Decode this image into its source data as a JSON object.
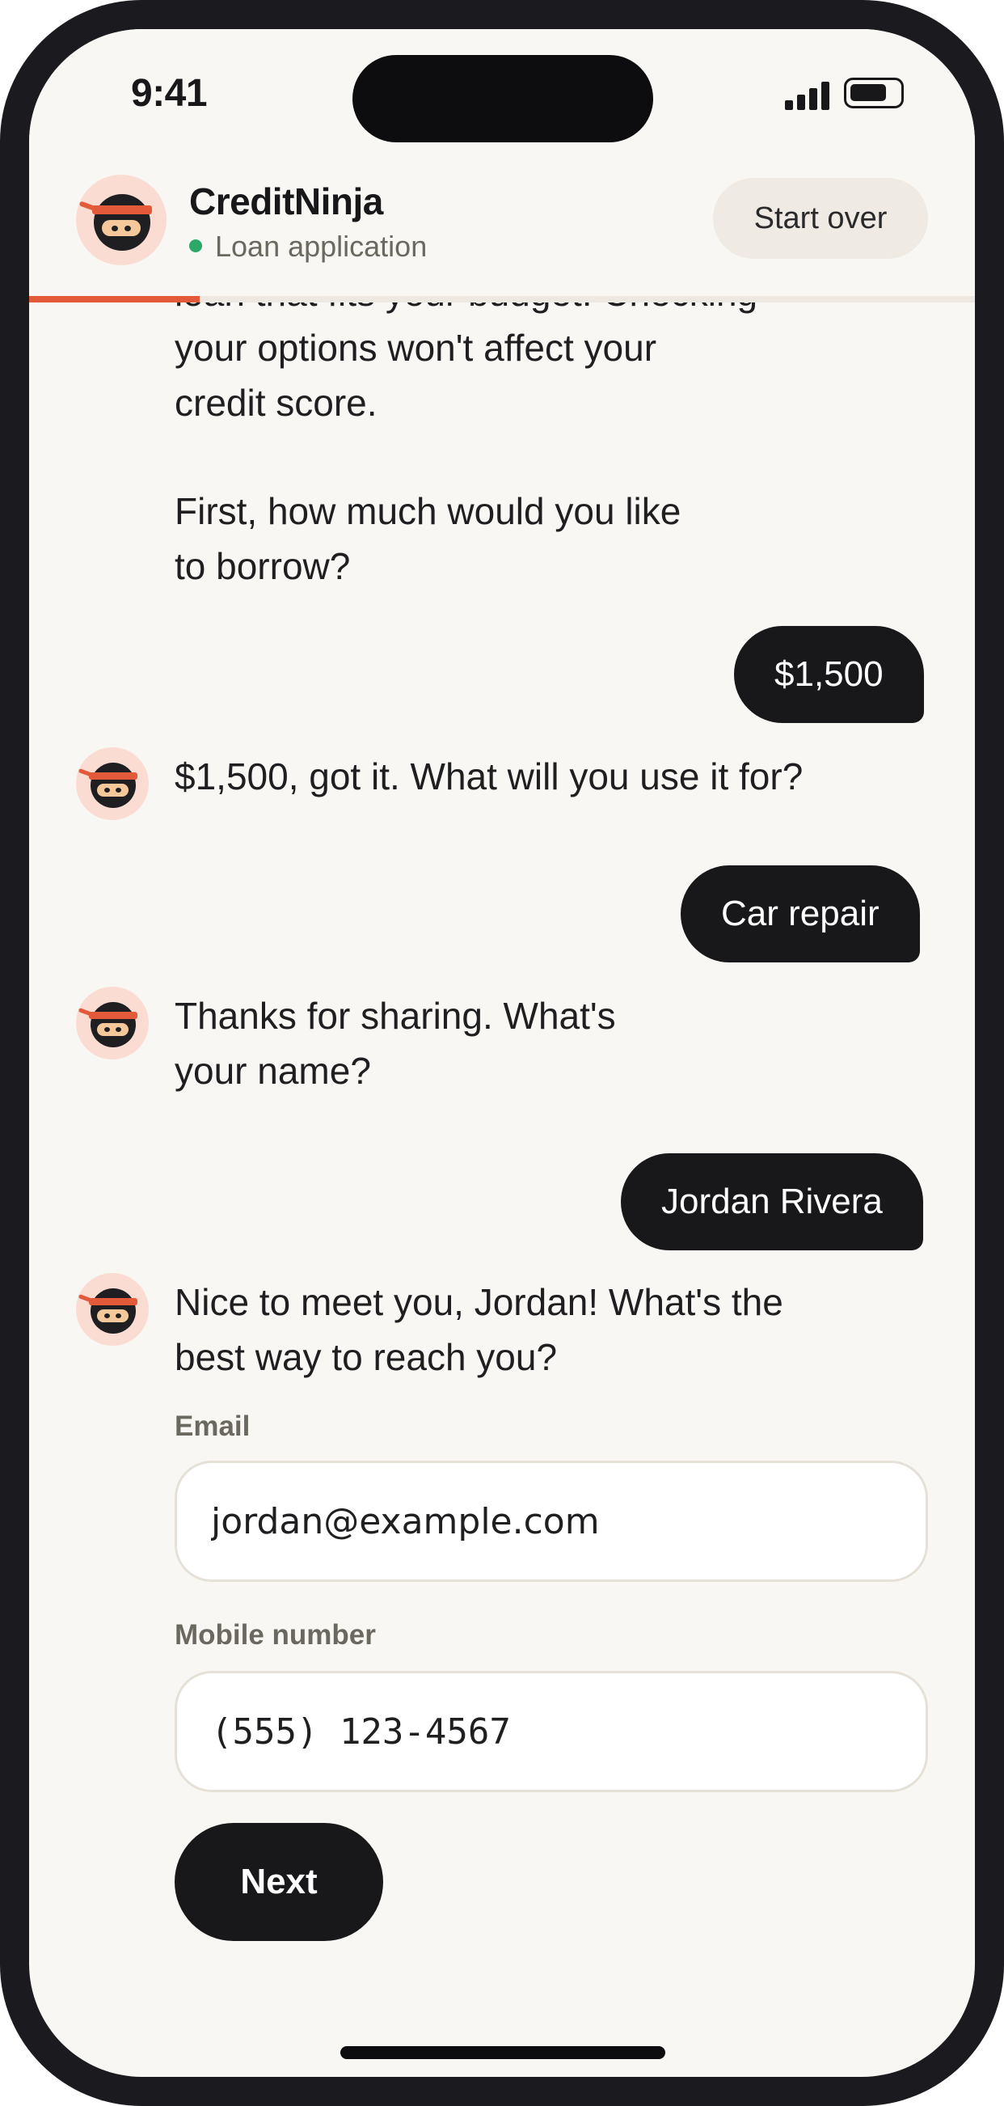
{
  "status_bar": {
    "time": "9:41"
  },
  "header": {
    "brand_name": "CreditNinja",
    "subtitle": "Loan application",
    "start_over_label": "Start over",
    "progress": 0.18
  },
  "chat": {
    "intro_partial_lines": [
      "loan that fits your budget. Checking",
      "your options won't affect your",
      "credit score."
    ],
    "question_amount": [
      "First, how much would you like",
      "to borrow?"
    ],
    "answer_amount": "$1,500",
    "question_purpose": "$1,500, got it. What will you use it for?",
    "answer_purpose": "Car repair",
    "question_name": [
      "Thanks for sharing. What's",
      "your name?"
    ],
    "answer_name": "Jordan Rivera",
    "question_contact": [
      "Nice to meet you, Jordan! What's the",
      "best way to reach you?"
    ]
  },
  "form": {
    "email_label": "Email",
    "email_value": "jordan@example.com",
    "mobile_label": "Mobile number",
    "mobile_value": "(555) 123-4567",
    "next_label": "Next"
  },
  "colors": {
    "accent": "#e35a3b",
    "dark": "#18181b",
    "background": "#f9f7f3",
    "online": "#2ea866"
  },
  "icons": [
    "signal-icon",
    "battery-icon",
    "ninja-avatar-icon"
  ]
}
